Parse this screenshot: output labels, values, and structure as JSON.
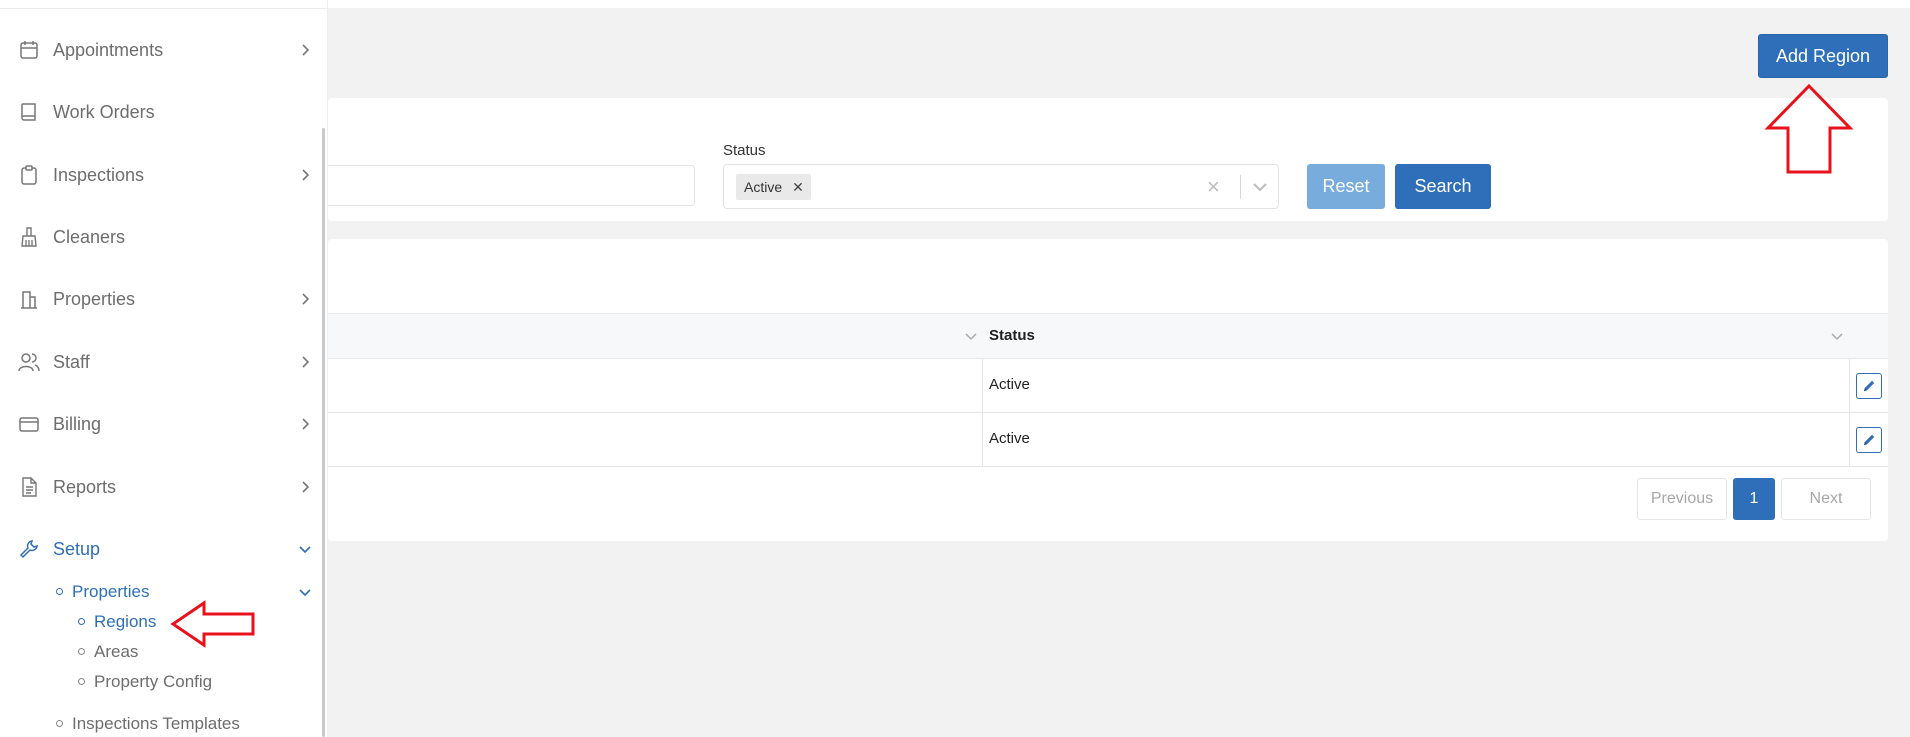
{
  "sidebar": {
    "items": [
      {
        "label": "Appointments",
        "icon": "calendar-icon",
        "has_chevron": true
      },
      {
        "label": "Work Orders",
        "icon": "book-icon",
        "has_chevron": false
      },
      {
        "label": "Inspections",
        "icon": "clipboard-icon",
        "has_chevron": true
      },
      {
        "label": "Cleaners",
        "icon": "broom-icon",
        "has_chevron": false
      },
      {
        "label": "Properties",
        "icon": "building-icon",
        "has_chevron": true
      },
      {
        "label": "Staff",
        "icon": "users-icon",
        "has_chevron": true
      },
      {
        "label": "Billing",
        "icon": "credit-card-icon",
        "has_chevron": true
      },
      {
        "label": "Reports",
        "icon": "document-icon",
        "has_chevron": true
      },
      {
        "label": "Setup",
        "icon": "wrench-icon",
        "has_chevron": true,
        "expanded": true
      }
    ],
    "setup_children": {
      "properties": "Properties",
      "regions": "Regions",
      "areas": "Areas",
      "property_config": "Property Config",
      "inspections_templates": "Inspections Templates"
    }
  },
  "header": {
    "add_button": "Add Region"
  },
  "filters": {
    "status_label": "Status",
    "status_chip": "Active",
    "reset_label": "Reset",
    "search_label": "Search"
  },
  "table": {
    "columns": [
      "Status"
    ],
    "rows": [
      {
        "status": "Active"
      },
      {
        "status": "Active"
      }
    ]
  },
  "pagination": {
    "previous": "Previous",
    "page": "1",
    "next": "Next"
  },
  "colors": {
    "primary": "#2f6fb9",
    "reset": "#77acdc",
    "annotation": "#e8121c"
  }
}
